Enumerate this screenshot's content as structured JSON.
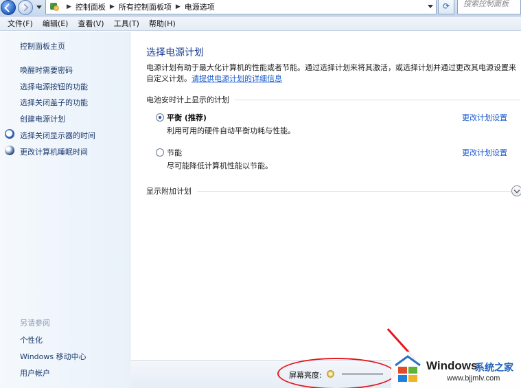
{
  "address_bar": {
    "breadcrumbs": [
      "控制面板",
      "所有控制面板项",
      "电源选项"
    ],
    "search_placeholder": "搜索控制面板"
  },
  "menu": [
    "文件(F)",
    "编辑(E)",
    "查看(V)",
    "工具(T)",
    "帮助(H)"
  ],
  "sidebar": {
    "home": "控制面板主页",
    "links": [
      "唤醒时需要密码",
      "选择电源按钮的功能",
      "选择关闭盖子的功能",
      "创建电源计划",
      "选择关闭显示器的时间",
      "更改计算机睡眠时间"
    ],
    "see_also_title": "另请参阅",
    "see_also": [
      "个性化",
      "Windows 移动中心",
      "用户帐户"
    ]
  },
  "main": {
    "title": "选择电源计划",
    "desc_text": "电源计划有助于最大化计算机的性能或者节能。通过选择计划来将其激活，或选择计划并通过更改其电源设置来自定义计划。",
    "desc_link": "请提供电源计划的详细信息",
    "battery_group": "电池安时计上显示的计划",
    "plans": [
      {
        "name": "平衡 (推荐)",
        "desc": "利用可用的硬件自动平衡功耗与性能。",
        "selected": true,
        "link": "更改计划设置"
      },
      {
        "name": "节能",
        "desc": "尽可能降低计算机性能以节能。",
        "selected": false,
        "link": "更改计划设置"
      }
    ],
    "extra_plans": "显示附加计划"
  },
  "bottom": {
    "brightness_label": "屏幕亮度:"
  },
  "watermark": {
    "brand": "Windows",
    "cn": "系统之家",
    "url": "www.bjjmlv.com"
  },
  "colors": {
    "link": "#1a5bcf",
    "title": "#1b3f8f",
    "annotation": "#e5171b"
  }
}
